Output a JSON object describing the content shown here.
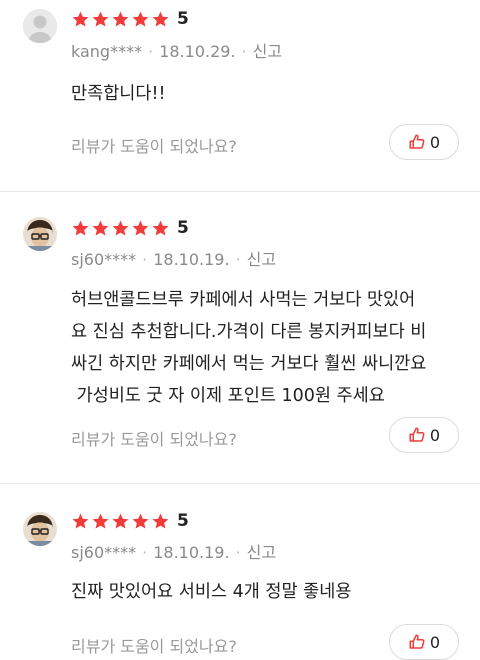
{
  "icons": {
    "star": "star-icon",
    "thumb": "thumbs-up-icon",
    "avatar": "avatar"
  },
  "colors": {
    "star": "#f23b3b",
    "thumb": "#f23b3b",
    "meta": "#8a8a8a"
  },
  "reviews": [
    {
      "rating": "5",
      "user": "kang****",
      "date": "18.10.29.",
      "report": "신고",
      "text": "만족합니다!!",
      "helpful": "리뷰가 도움이 되었나요?",
      "likes": "0"
    },
    {
      "rating": "5",
      "user": "sj60****",
      "date": "18.10.19.",
      "report": "신고",
      "text": "허브앤콜드브루 카페에서 사먹는 거보다 맛있어\n요 진심 추천합니다.가격이 다른 봉지커피보다 비\n싸긴 하지만 카페에서 먹는 거보다 훨씬 싸니깐요\n 가성비도 굿 자 이제 포인트 100원 주세요",
      "helpful": "리뷰가 도움이 되었나요?",
      "likes": "0"
    },
    {
      "rating": "5",
      "user": "sj60****",
      "date": "18.10.19.",
      "report": "신고",
      "text": "진짜 맛있어요 서비스 4개 정말 좋네용",
      "helpful": "리뷰가 도움이 되었나요?",
      "likes": "0"
    }
  ]
}
